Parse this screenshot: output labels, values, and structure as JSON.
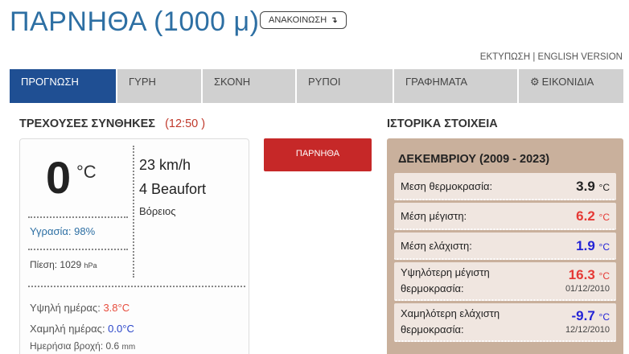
{
  "header": {
    "title": "ΠΑΡΝΗΘΑ (1000 μ)",
    "announce_label": "ΑΝΑΚΟΙΝΩΣΗ",
    "announce_icon": "↴"
  },
  "toplinks": {
    "print": "ΕΚΤΥΠΩΣΗ",
    "separator": " | ",
    "english": "ENGLISH VERSION"
  },
  "tabs": [
    {
      "label": "ΠΡΟΓΝΩΣΗ",
      "active": true
    },
    {
      "label": "ΓΥΡΗ",
      "active": false
    },
    {
      "label": "ΣΚΟΝΗ",
      "active": false
    },
    {
      "label": "ΡΥΠΟΙ",
      "active": false
    },
    {
      "label": "ΓΡΑΦΗΜΑΤΑ",
      "active": false
    },
    {
      "label": "ΕΙΚΟΝΙΔΙΑ",
      "active": false,
      "icon": "gear-icon"
    }
  ],
  "current": {
    "section_title": "ΤΡΕΧΟΥΣΕΣ ΣΥΝΘΗΚΕΣ",
    "time_open": "(",
    "time": "12:50",
    "time_close": " )",
    "temperature": "0",
    "temperature_unit": "°C",
    "wind_speed": "23 km/h",
    "wind_beaufort": "4 Beaufort",
    "wind_direction": "Βόρειος",
    "humidity": "Υγρασία: 98%",
    "pressure_label": "Πίεση: 1029",
    "pressure_unit": "hPa",
    "high_label": "Υψηλή ημέρας: ",
    "high_value": "3.8°C",
    "low_label": "Χαμηλή ημέρας: ",
    "low_value": "0.0°C",
    "rain_label": "Ημερήσια βροχή: 0.6",
    "rain_unit": "mm"
  },
  "station_button": "ΠΑΡΝΗΘΑ",
  "history": {
    "section_title": "ΙΣΤΟΡΙΚΑ ΣΤΟΙΧΕΙΑ",
    "period": "ΔΕΚΕΜΒΡΙΟΥ (2009 - 2023)",
    "unit": "°C",
    "rows": [
      {
        "label": "Μεση θερμοκρασία:",
        "value": "3.9",
        "color": "#222222"
      },
      {
        "label": "Μέση μέγιστη:",
        "value": "6.2",
        "color": "#e53935"
      },
      {
        "label": "Μέση ελάχιστη:",
        "value": "1.9",
        "color": "#2424d6"
      },
      {
        "label_1": "Υψηλότερη μέγιστη",
        "label_2": "θερμοκρασία:",
        "value": "16.3",
        "date": "01/12/2010",
        "color": "#e53935"
      },
      {
        "label_1": "Χαμηλότερη ελάχιστη",
        "label_2": "θερμοκρασία:",
        "value": "-9.7",
        "date": "12/12/2010",
        "color": "#2424d6"
      }
    ]
  },
  "colors": {
    "accent_blue": "#1f4f93",
    "title_blue": "#2d6fa3",
    "station_red": "#c62828",
    "history_bg": "#c9b09c"
  }
}
